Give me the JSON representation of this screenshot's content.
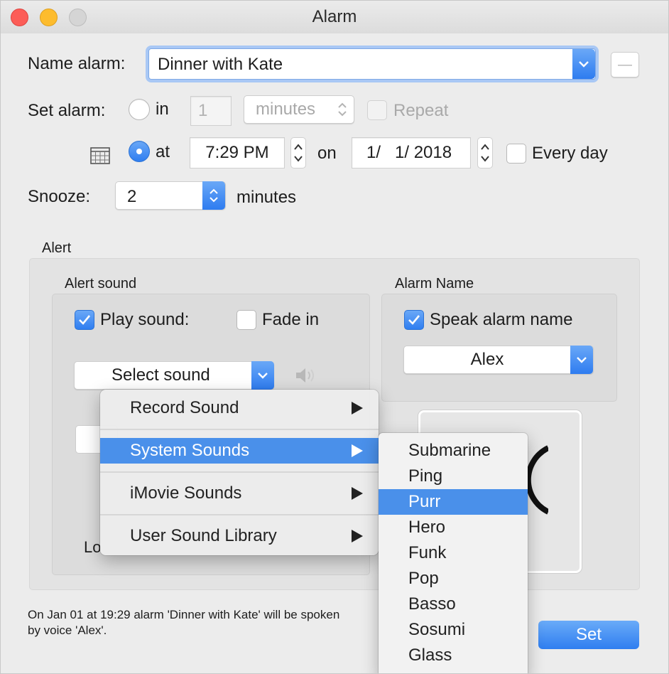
{
  "window": {
    "title": "Alarm"
  },
  "name_alarm": {
    "label": "Name alarm:",
    "value": "Dinner with Kate",
    "minus_label": "—"
  },
  "set_alarm": {
    "label": "Set alarm:",
    "in_label": "in",
    "in_value": "1",
    "units": "minutes",
    "repeat_label": "Repeat",
    "at_label": "at",
    "time": "7:29 PM",
    "on_label": "on",
    "date": "1/   1/ 2018",
    "every_day_label": "Every day",
    "mode": "at"
  },
  "snooze": {
    "label": "Snooze:",
    "value": "2",
    "unit": "minutes"
  },
  "alert": {
    "label": "Alert",
    "sound_group": "Alert sound",
    "play_sound_label": "Play sound:",
    "play_sound_checked": true,
    "fade_in_label": "Fade in",
    "fade_in_checked": false,
    "select_sound_label": "Select sound",
    "partial_label": "Lo"
  },
  "alarm_name": {
    "label": "Alarm Name",
    "speak_label": "Speak alarm name",
    "speak_checked": true,
    "voice": "Alex"
  },
  "sound_menu": {
    "items": [
      {
        "label": "Record Sound",
        "highlighted": false
      },
      {
        "label": "System Sounds",
        "highlighted": true
      },
      {
        "label": "iMovie Sounds",
        "highlighted": false
      },
      {
        "label": "User Sound Library",
        "highlighted": false
      }
    ]
  },
  "system_sounds": {
    "items": [
      {
        "label": "Submarine",
        "highlighted": false
      },
      {
        "label": "Ping",
        "highlighted": false
      },
      {
        "label": "Purr",
        "highlighted": true
      },
      {
        "label": "Hero",
        "highlighted": false
      },
      {
        "label": "Funk",
        "highlighted": false
      },
      {
        "label": "Pop",
        "highlighted": false
      },
      {
        "label": "Basso",
        "highlighted": false
      },
      {
        "label": "Sosumi",
        "highlighted": false
      },
      {
        "label": "Glass",
        "highlighted": false
      },
      {
        "label": "Blow",
        "highlighted": false
      }
    ]
  },
  "status": {
    "line1": "On Jan 01 at 19:29 alarm 'Dinner with Kate' will be spoken",
    "line2": "by voice 'Alex'."
  },
  "set_button": "Set",
  "colors": {
    "accent": "#2f7ef0",
    "highlight": "#4a90ea",
    "window_bg": "#ececec"
  }
}
